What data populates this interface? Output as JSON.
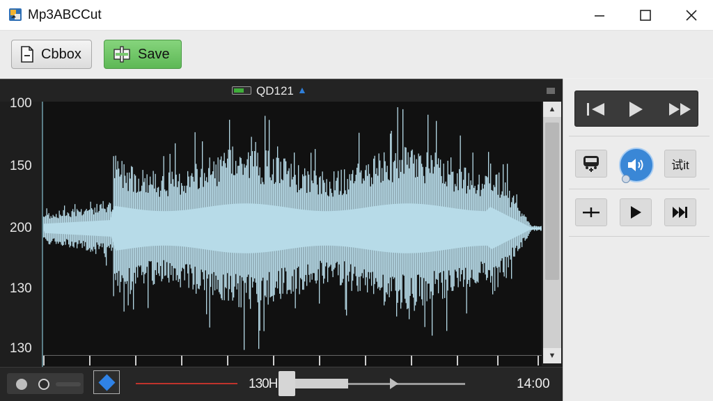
{
  "window": {
    "title": "Mp3ABCCut",
    "controls": {
      "minimize": "minimize-icon",
      "maximize": "maximize-icon",
      "close": "close-icon"
    }
  },
  "toolbar": {
    "cbbox_label": "Cbbox",
    "save_label": "Save"
  },
  "waveform": {
    "track_name": "QD121",
    "y_labels": [
      "100",
      "150",
      "200",
      "130",
      "130"
    ]
  },
  "transport": {
    "current_time": "130H",
    "total_time": "14:00"
  },
  "right_panel": {
    "trial_label": "试it"
  },
  "colors": {
    "waveform": "#b7dbe8",
    "accent": "#3a87d6",
    "save_button": "#6cc463",
    "marker": "#2f82e6",
    "selection_line": "#c0332c"
  }
}
